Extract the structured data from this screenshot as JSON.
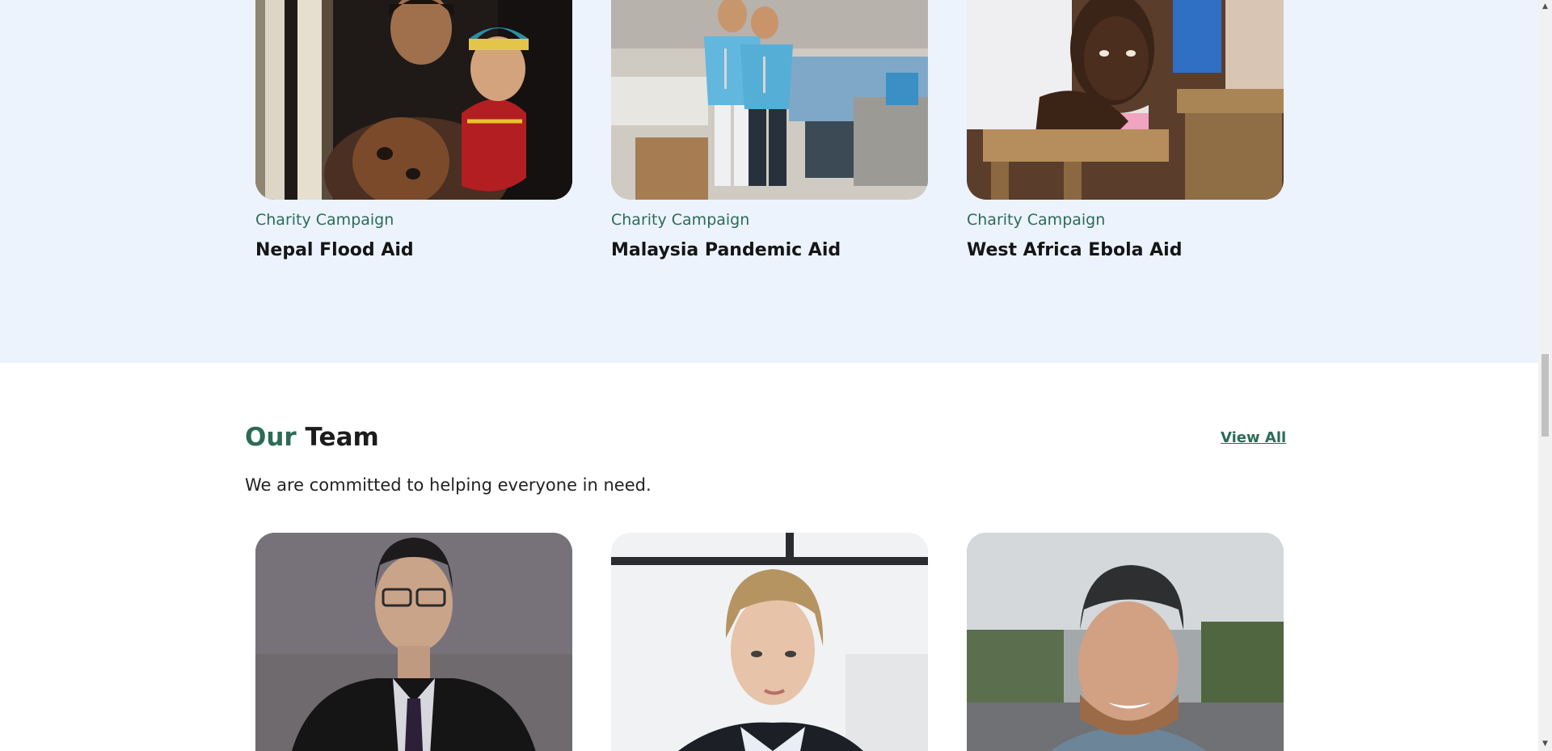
{
  "campaigns": [
    {
      "kicker": "Charity Campaign",
      "title": "Nepal Flood Aid"
    },
    {
      "kicker": "Charity Campaign",
      "title": "Malaysia Pandemic Aid"
    },
    {
      "kicker": "Charity Campaign",
      "title": "West Africa Ebola Aid"
    }
  ],
  "team": {
    "heading_accent": "Our",
    "heading_rest": "Team",
    "view_all": "View All",
    "subtitle": "We are committed to helping everyone in need."
  },
  "scrollbar": {
    "up_glyph": "▲",
    "down_glyph": "▼"
  },
  "colors": {
    "accent": "#2c6b57",
    "section_bg": "#ecf3fd"
  }
}
